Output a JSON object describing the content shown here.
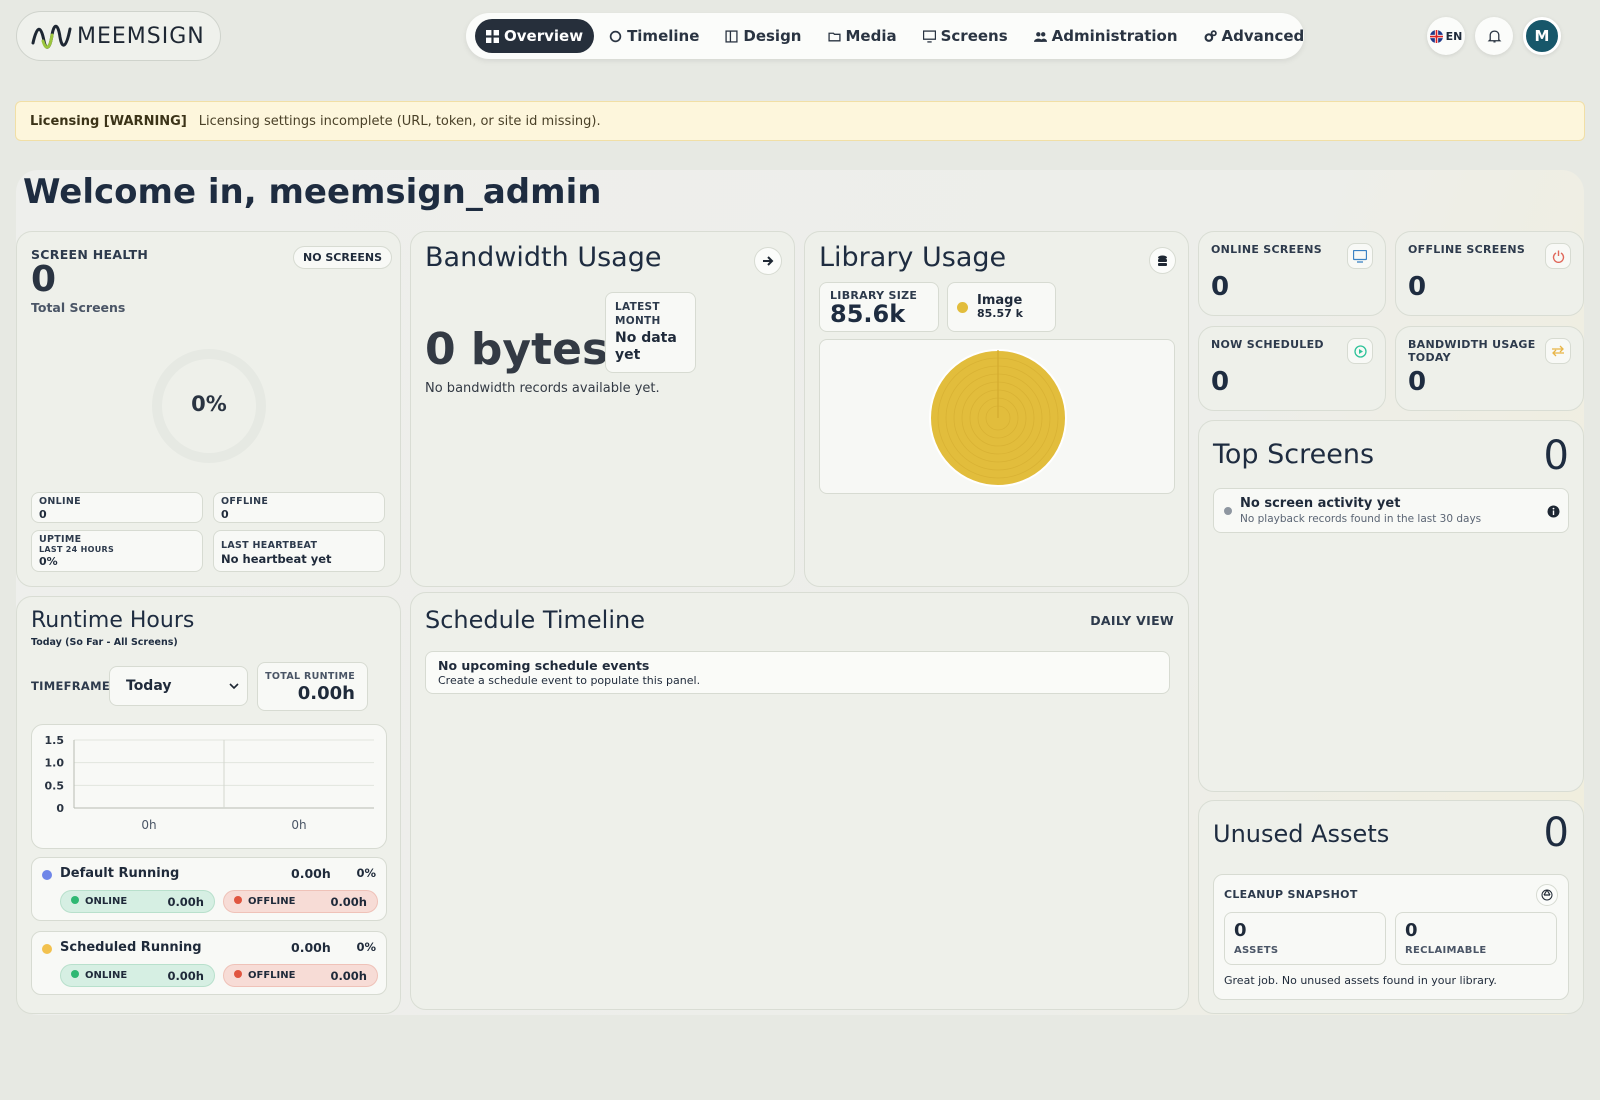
{
  "brand": {
    "logo_text": "MEEMSIGN"
  },
  "nav": {
    "items": [
      {
        "label": "Overview",
        "icon": "grid-icon"
      },
      {
        "label": "Timeline",
        "icon": "circle-icon"
      },
      {
        "label": "Design",
        "icon": "columns-icon"
      },
      {
        "label": "Media",
        "icon": "folder-icon"
      },
      {
        "label": "Screens",
        "icon": "monitor-icon"
      },
      {
        "label": "Administration",
        "icon": "users-icon"
      },
      {
        "label": "Advanced",
        "icon": "gears-icon"
      }
    ],
    "active": "Overview"
  },
  "header": {
    "lang": "EN",
    "avatar_initial": "M"
  },
  "warning": {
    "title": "Licensing [WARNING]",
    "message": "Licensing settings incomplete (URL, token, or site id missing)."
  },
  "welcome": "Welcome in, meemsign_admin",
  "screen_health": {
    "title": "SCREEN HEALTH",
    "badge": "NO SCREENS",
    "count": "0",
    "count_label": "Total Screens",
    "percent": "0%",
    "online_label": "ONLINE",
    "online_value": "0",
    "offline_label": "OFFLINE",
    "offline_value": "0",
    "uptime_label": "UPTIME",
    "uptime_sub": "LAST 24 HOURS",
    "uptime_value": "0%",
    "heartbeat_label": "LAST HEARTBEAT",
    "heartbeat_value": "No heartbeat yet"
  },
  "bandwidth": {
    "title": "Bandwidth Usage",
    "value": "0 bytes",
    "latest_label": "LATEST MONTH",
    "latest_value": "No data yet",
    "note": "No bandwidth records available yet."
  },
  "library": {
    "title": "Library Usage",
    "size_label": "LIBRARY SIZE",
    "size_value": "85.6k",
    "legend_name": "Image",
    "legend_value": "85.57 k",
    "color": "#e2bd3c"
  },
  "stats": {
    "online": {
      "label": "ONLINE SCREENS",
      "value": "0",
      "icon": "monitor-icon",
      "color": "#3b82c4"
    },
    "offline": {
      "label": "OFFLINE SCREENS",
      "value": "0",
      "icon": "power-icon",
      "color": "#e0675a"
    },
    "scheduled": {
      "label": "NOW SCHEDULED",
      "value": "0",
      "icon": "play-icon",
      "color": "#2fc39a"
    },
    "bandwidth_today": {
      "label": "BANDWIDTH USAGE TODAY",
      "value": "0",
      "icon": "transfer-icon",
      "color": "#e8b547"
    }
  },
  "top_screens": {
    "title": "Top Screens",
    "count": "0",
    "empty_title": "No screen activity yet",
    "empty_sub": "No playback records found in the last 30 days"
  },
  "runtime": {
    "title": "Runtime Hours",
    "subtitle": "Today (So Far - All Screens)",
    "timeframe_label": "TIMEFRAME",
    "timeframe_value": "Today",
    "total_label": "TOTAL RUNTIME",
    "total_value": "0.00h",
    "rows": [
      {
        "name": "Default Running",
        "hours": "0.00h",
        "pct": "0%",
        "color": "#6f86e8",
        "online_label": "ONLINE",
        "online": "0.00h",
        "offline_label": "OFFLINE",
        "offline": "0.00h"
      },
      {
        "name": "Scheduled Running",
        "hours": "0.00h",
        "pct": "0%",
        "color": "#f2c14e",
        "online_label": "ONLINE",
        "online": "0.00h",
        "offline_label": "OFFLINE",
        "offline": "0.00h"
      }
    ]
  },
  "chart_data": {
    "type": "bar",
    "categories": [
      "0h",
      "0h"
    ],
    "values": [
      0,
      0
    ],
    "yticks": [
      "1.5",
      "1.0",
      "0.5",
      "0"
    ],
    "ylim": [
      0,
      1.5
    ],
    "grid": true
  },
  "schedule": {
    "title": "Schedule Timeline",
    "view": "DAILY VIEW",
    "empty_title": "No upcoming schedule events",
    "empty_sub": "Create a schedule event to populate this panel."
  },
  "unused": {
    "title": "Unused Assets",
    "count": "0",
    "snapshot_label": "CLEANUP SNAPSHOT",
    "assets_value": "0",
    "assets_label": "ASSETS",
    "reclaim_value": "0",
    "reclaim_label": "RECLAIMABLE",
    "note": "Great job. No unused assets found in your library."
  }
}
